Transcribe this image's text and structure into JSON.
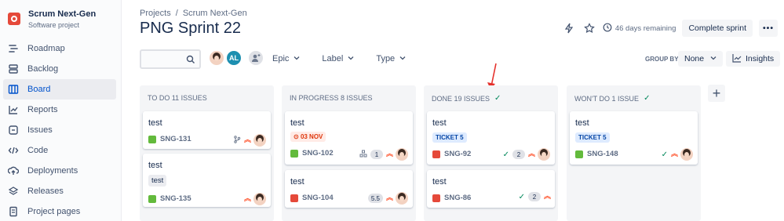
{
  "project": {
    "name": "Scrum Next-Gen",
    "type": "Software project"
  },
  "sidebar": {
    "items": [
      {
        "label": "Roadmap",
        "icon": "roadmap-icon"
      },
      {
        "label": "Backlog",
        "icon": "backlog-icon"
      },
      {
        "label": "Board",
        "icon": "board-icon",
        "active": true
      },
      {
        "label": "Reports",
        "icon": "reports-icon"
      },
      {
        "label": "Issues",
        "icon": "issues-icon"
      },
      {
        "label": "Code",
        "icon": "code-icon"
      },
      {
        "label": "Deployments",
        "icon": "deployments-icon"
      },
      {
        "label": "Releases",
        "icon": "releases-icon"
      },
      {
        "label": "Project pages",
        "icon": "pages-icon"
      }
    ]
  },
  "breadcrumb": {
    "projects": "Projects",
    "separator": "/",
    "current": "Scrum Next-Gen"
  },
  "header": {
    "title": "PNG Sprint 22",
    "remaining": "46 days remaining",
    "complete_label": "Complete sprint",
    "more_label": "•••"
  },
  "toolbar": {
    "search_placeholder": "",
    "avatar_initials": "AL",
    "filters": {
      "epic": "Epic",
      "label": "Label",
      "type": "Type"
    },
    "group_by_label": "GROUP BY",
    "group_by_value": "None",
    "insights_label": "Insights"
  },
  "columns": [
    {
      "title": "TO DO 11 ISSUES",
      "cards": [
        {
          "title": "test",
          "key": "SNG-131",
          "type": "story"
        },
        {
          "title": "test",
          "label": "test",
          "key": "SNG-135",
          "type": "story"
        }
      ]
    },
    {
      "title": "IN PROGRESS 8 ISSUES",
      "cards": [
        {
          "title": "test",
          "due": "03 NOV",
          "key": "SNG-102",
          "type": "story",
          "points": "1"
        },
        {
          "title": "test",
          "key": "SNG-104",
          "type": "bug",
          "points": "5.5"
        }
      ]
    },
    {
      "title": "DONE 19 ISSUES",
      "cards": [
        {
          "title": "test",
          "label": "TICKET 5",
          "key": "SNG-92",
          "type": "bug",
          "points": "2"
        },
        {
          "title": "test",
          "key": "SNG-86",
          "type": "bug",
          "points": "2"
        }
      ]
    },
    {
      "title": "WON'T DO 1 ISSUE",
      "cards": [
        {
          "title": "test",
          "label": "TICKET 5",
          "key": "SNG-148",
          "type": "story"
        }
      ]
    }
  ],
  "colors": {
    "accent": "#0052cc",
    "bug": "#e5493a",
    "story": "#63ba3c",
    "priority": "#ff5630",
    "done_check": "#00875a",
    "annotation_arrow": "#e5322d"
  }
}
